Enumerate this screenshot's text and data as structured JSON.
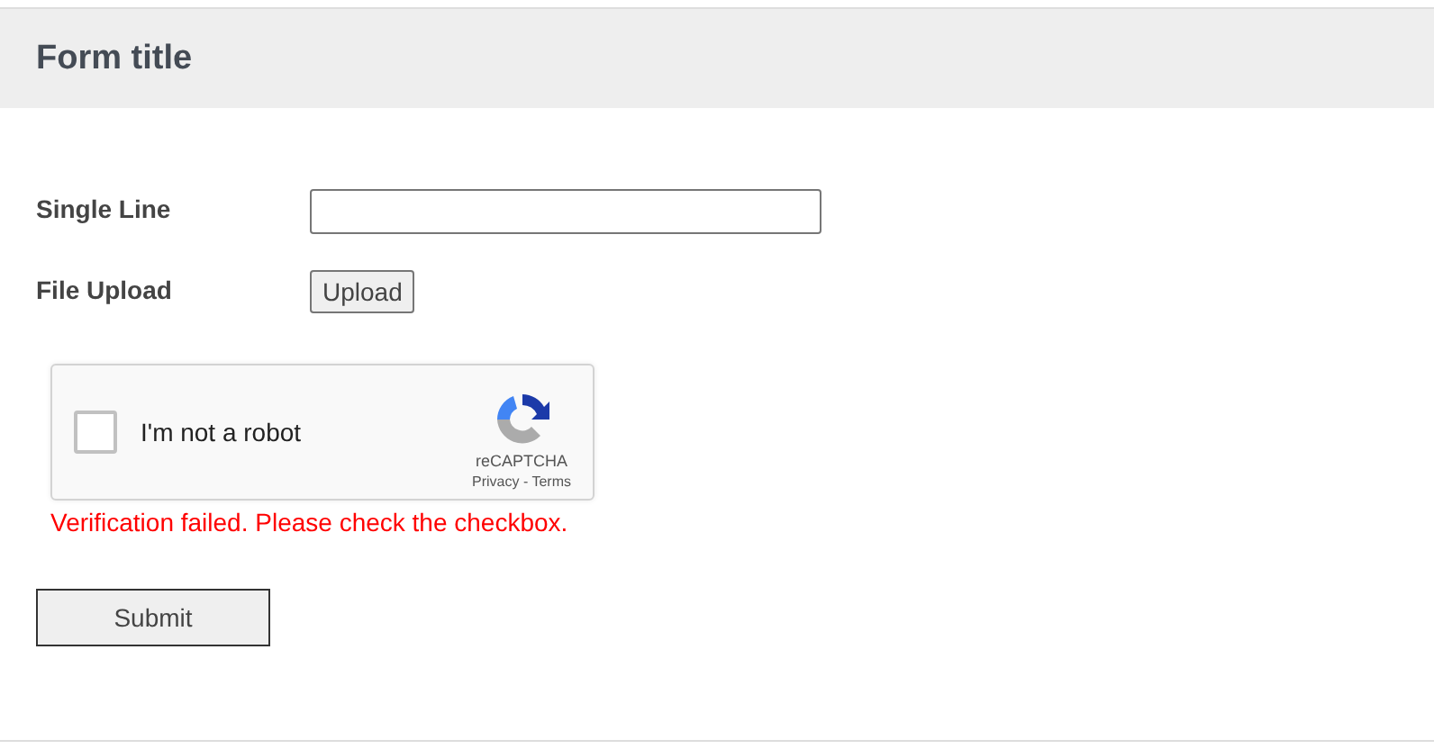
{
  "form": {
    "title": "Form title"
  },
  "fields": [
    {
      "kind": "text",
      "label": "Single Line"
    },
    {
      "kind": "file",
      "label": "File Upload",
      "button": "Upload"
    }
  ],
  "captcha": {
    "label": "I'm not a robot",
    "checked": false,
    "brand": "reCAPTCHA",
    "links": "Privacy - Terms",
    "error": "Verification failed. Please check the checkbox."
  },
  "submit": "Submit"
}
